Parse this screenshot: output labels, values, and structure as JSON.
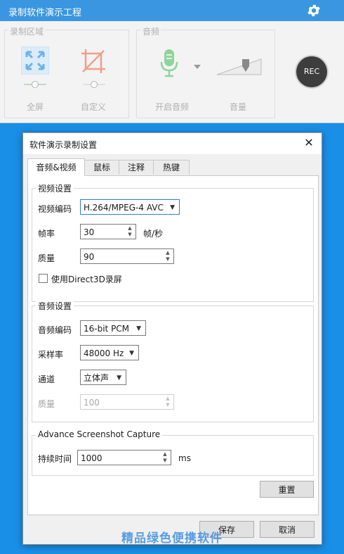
{
  "app": {
    "title": "录制软件演示工程",
    "group_region": "录制区域",
    "group_audio": "音频",
    "tools": {
      "fullscreen": "全屏",
      "custom": "自定义",
      "enable_audio": "开启音频",
      "volume": "音量"
    },
    "rec_label": "REC",
    "icons": {
      "settings": "gear-icon",
      "fullscreen": "expand-arrows-icon",
      "custom": "crop-icon",
      "mic": "microphone-icon",
      "volume": "volume-slider-icon"
    },
    "colors": {
      "title_bar": "#3a96e0",
      "background": "#1a8fe8"
    }
  },
  "dialog": {
    "title": "软件演示录制设置",
    "close": "✕",
    "tabs": [
      "音频&视频",
      "鼠标",
      "注释",
      "热键"
    ],
    "video": {
      "legend": "视频设置",
      "codec_label": "视频编码",
      "codec_value": "H.264/MPEG-4 AVC",
      "fps_label": "帧率",
      "fps_value": "30",
      "fps_unit": "帧/秒",
      "quality_label": "质量",
      "quality_value": "90",
      "direct3d_label": "使用Direct3D录屏"
    },
    "audio": {
      "legend": "音频设置",
      "codec_label": "音频编码",
      "codec_value": "16-bit PCM",
      "samplerate_label": "采样率",
      "samplerate_value": "48000 Hz",
      "channel_label": "通道",
      "channel_value": "立体声",
      "quality_label": "质量",
      "quality_value": "100"
    },
    "screenshot": {
      "legend": "Advance Screenshot Capture",
      "duration_label": "持续时间",
      "duration_value": "1000",
      "duration_unit": "ms"
    },
    "reset": "重置",
    "save": "保存",
    "cancel": "取消"
  },
  "watermark": "精品绿色便携软件"
}
